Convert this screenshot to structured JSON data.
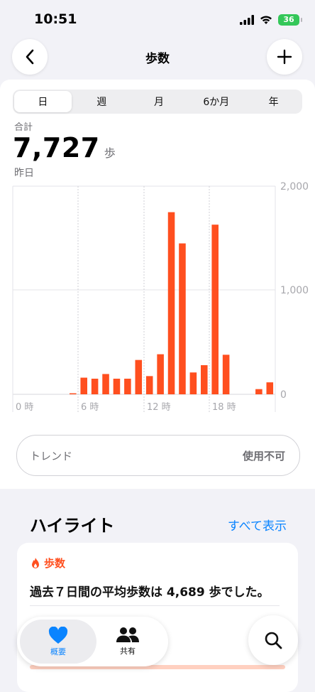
{
  "status": {
    "time": "10:51",
    "battery": "36"
  },
  "nav": {
    "title": "歩数"
  },
  "segments": [
    "日",
    "週",
    "月",
    "6か月",
    "年"
  ],
  "summary": {
    "label": "合計",
    "value": "7,727",
    "unit": "歩",
    "date": "昨日"
  },
  "chart_data": {
    "type": "bar",
    "categories": [
      "0",
      "1",
      "2",
      "3",
      "4",
      "5",
      "6",
      "7",
      "8",
      "9",
      "10",
      "11",
      "12",
      "13",
      "14",
      "15",
      "16",
      "17",
      "18",
      "19",
      "20",
      "21",
      "22",
      "23"
    ],
    "values": [
      0,
      0,
      0,
      0,
      0,
      10,
      160,
      150,
      195,
      150,
      150,
      330,
      175,
      385,
      1750,
      1450,
      210,
      280,
      1630,
      380,
      0,
      0,
      50,
      115
    ],
    "xticks": [
      "0 時",
      "6 時",
      "12 時",
      "18 時"
    ],
    "yticks": [
      "0",
      "1,000",
      "2,000"
    ],
    "ylim": [
      0,
      2000
    ],
    "color": "#ff4f1f"
  },
  "trend": {
    "label": "トレンド",
    "value": "使用不可"
  },
  "highlights": {
    "title": "ハイライト",
    "show_all": "すべて表示",
    "tag": "歩数",
    "text": "過去７日間の平均歩数は 4,689 歩でした。"
  },
  "tabbar": {
    "summary": "概要",
    "sharing": "共有"
  }
}
